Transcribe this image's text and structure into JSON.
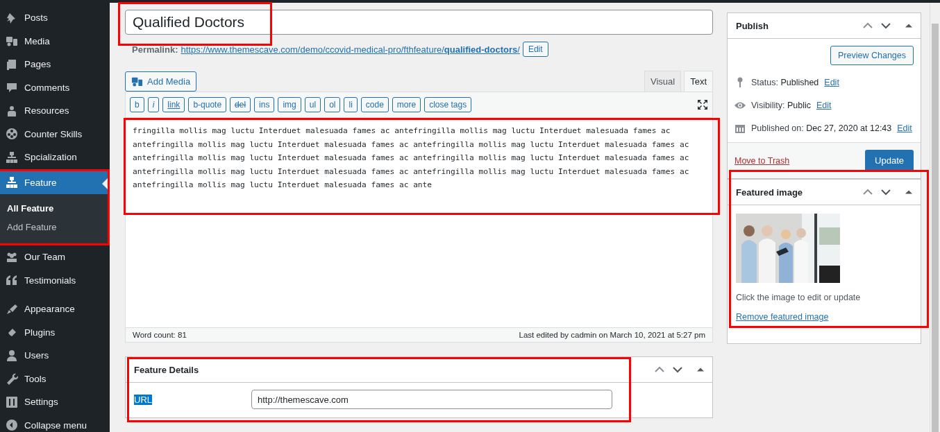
{
  "sidebar": {
    "groups": [
      [
        {
          "label": "Posts",
          "selected": false
        },
        {
          "label": "Media",
          "selected": false
        },
        {
          "label": "Pages",
          "selected": false
        },
        {
          "label": "Comments",
          "selected": false
        },
        {
          "label": "Resources",
          "selected": false
        },
        {
          "label": "Counter Skills",
          "selected": false
        },
        {
          "label": "Spcialization",
          "selected": false
        },
        {
          "label": "Feature",
          "selected": true,
          "highlighted": true,
          "children": [
            {
              "label": "All Feature",
              "selected": true
            },
            {
              "label": "Add Feature",
              "selected": false
            }
          ]
        },
        {
          "label": "Our Team",
          "selected": false
        },
        {
          "label": "Testimonials",
          "selected": false
        }
      ],
      [
        {
          "label": "Appearance",
          "selected": false
        },
        {
          "label": "Plugins",
          "selected": false
        },
        {
          "label": "Users",
          "selected": false
        },
        {
          "label": "Tools",
          "selected": false
        },
        {
          "label": "Settings",
          "selected": false
        },
        {
          "label": "Collapse menu",
          "selected": false
        }
      ]
    ]
  },
  "title": {
    "value": "Qualified Doctors",
    "highlighted": true
  },
  "permalink": {
    "label": "Permalink:",
    "url_base": "https://www.themescave.com/demo/ccovid-medical-pro/fthfeature/",
    "slug": "qualified-doctors",
    "trail": "/",
    "button": "Edit"
  },
  "add_media": "Add Media",
  "editor_tabs": [
    {
      "label": "Visual",
      "selected": false
    },
    {
      "label": "Text",
      "selected": true
    }
  ],
  "quicktags": [
    "b",
    "i",
    "link",
    "b-quote",
    "del",
    "ins",
    "img",
    "ul",
    "ol",
    "li",
    "code",
    "more",
    "close tags"
  ],
  "content": {
    "text": "fringilla mollis mag luctu Interduet malesuada fames ac antefringilla mollis mag luctu Interduet malesuada fames ac antefringilla mollis mag luctu Interduet malesuada fames ac antefringilla mollis mag luctu Interduet malesuada fames ac antefringilla mollis mag luctu Interduet malesuada fames ac antefringilla mollis mag luctu Interduet malesuada fames ac antefringilla mollis mag luctu Interduet malesuada fames ac antefringilla mollis mag luctu Interduet malesuada fames ac antefringilla mollis mag luctu Interduet malesuada fames ac ante",
    "highlighted": true
  },
  "status_bar": {
    "word_count": "Word count: 81",
    "last_edited": "Last edited by cadmin on March 10, 2021 at 5:27 pm"
  },
  "feature_details": {
    "title": "Feature Details",
    "highlighted": true,
    "fields": [
      {
        "label": "URL",
        "label_selected": true,
        "value": "http://themescave.com"
      }
    ]
  },
  "publish": {
    "title": "Publish",
    "preview": "Preview Changes",
    "rows": [
      {
        "label": "Status:",
        "value": "Published",
        "link": "Edit"
      },
      {
        "label": "Visibility:",
        "value": "Public",
        "link": "Edit"
      },
      {
        "label": "Published on:",
        "value": "Dec 27, 2020 at 12:43",
        "link": "Edit"
      }
    ],
    "trash": "Move to Trash",
    "update": "Update"
  },
  "featured_image": {
    "title": "Featured image",
    "highlighted": true,
    "hint": "Click the image to edit or update",
    "remove": "Remove featured image"
  }
}
